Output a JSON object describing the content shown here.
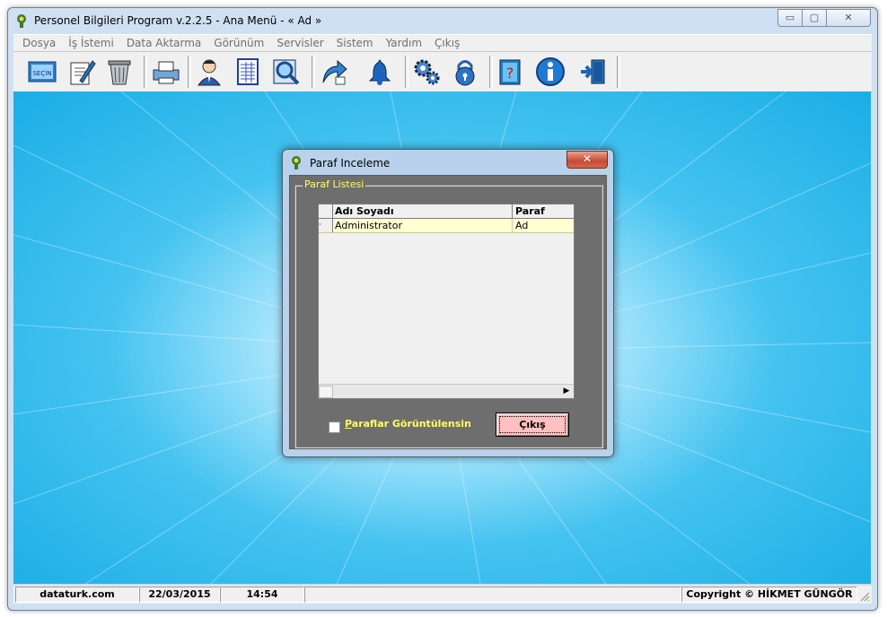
{
  "window": {
    "title": "Personel Bilgileri Program v.2.2.5  - Ana Menü -  « Ad »",
    "minimize": "▭",
    "maximize": "▢",
    "close": "✕"
  },
  "menu": [
    "Dosya",
    "İş İstemi",
    "Data Aktarma",
    "Görünüm",
    "Servisler",
    "Sistem",
    "Yardım",
    "Çıkış"
  ],
  "toolbar": {
    "icons": [
      "secin-icon",
      "edit-document-icon",
      "recycle-bin-icon",
      "printer-icon",
      "user-icon",
      "report-sheet-icon",
      "search-icon",
      "export-arrow-icon",
      "bell-icon",
      "gears-icon",
      "lock-icon",
      "help-book-icon",
      "info-icon",
      "exit-door-icon"
    ],
    "secin_label": "SEÇİN"
  },
  "dialog": {
    "title": "Paraf Inceleme",
    "close": "✕",
    "group_label": "Paraf Listesi",
    "columns": [
      "Adı Soyadı",
      "Paraf"
    ],
    "rows": [
      [
        "Administrator",
        "Ad"
      ]
    ],
    "checkbox_label_prefix": "P",
    "checkbox_label_rest": "araflar Görüntülensin",
    "exit_label": "Çıkış"
  },
  "status": {
    "site": "dataturk.com",
    "date": "22/03/2015",
    "time": "14:54",
    "copyright": "Copyright © HİKMET GÜNGÖR"
  },
  "colors": {
    "workspace": "#1aaee6",
    "dialog_body": "#6e6e6e",
    "group_label": "#ffff66",
    "grid_row": "#ffffd2",
    "exit_button": "#ffc0c0"
  }
}
